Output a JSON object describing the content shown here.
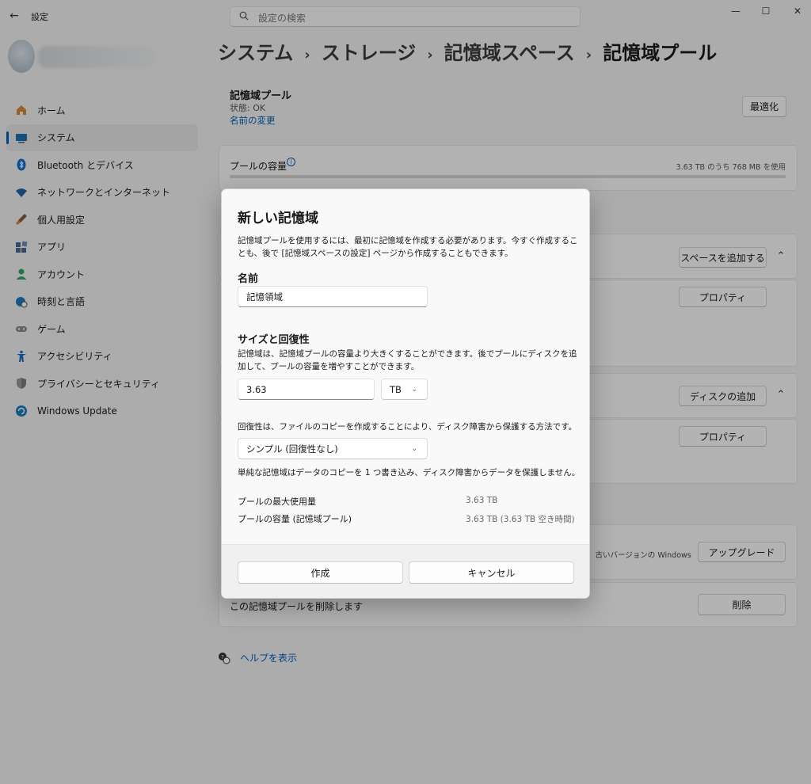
{
  "app": {
    "title": "設定"
  },
  "search": {
    "placeholder": "設定の検索"
  },
  "sidebar": {
    "items": [
      {
        "label": "ホーム",
        "icon": "home-icon",
        "color": "#d9883b"
      },
      {
        "label": "システム",
        "icon": "system-icon",
        "color": "#1f6fb2"
      },
      {
        "label": "Bluetooth とデバイス",
        "icon": "bluetooth-icon",
        "color": "#0a6ed1"
      },
      {
        "label": "ネットワークとインターネット",
        "icon": "wifi-icon",
        "color": "#2563a8"
      },
      {
        "label": "個人用設定",
        "icon": "brush-icon",
        "color": "#d2885a"
      },
      {
        "label": "アプリ",
        "icon": "apps-icon",
        "color": "#4a6c8c"
      },
      {
        "label": "アカウント",
        "icon": "account-icon",
        "color": "#2ea56b"
      },
      {
        "label": "時刻と言語",
        "icon": "globe-clock-icon",
        "color": "#1c7bc0"
      },
      {
        "label": "ゲーム",
        "icon": "gamepad-icon",
        "color": "#777777"
      },
      {
        "label": "アクセシビリティ",
        "icon": "accessibility-icon",
        "color": "#1c6fc4"
      },
      {
        "label": "プライバシーとセキュリティ",
        "icon": "shield-icon",
        "color": "#777777"
      },
      {
        "label": "Windows Update",
        "icon": "update-icon",
        "color": "#1c7bc0"
      }
    ]
  },
  "breadcrumb": [
    "システム",
    "ストレージ",
    "記憶域スペース",
    "記憶域プール"
  ],
  "pool": {
    "title": "記憶域プール",
    "status": "状態: OK",
    "rename": "名前の変更",
    "optimize": "最適化",
    "capacity_label": "プールの容量",
    "capacity_usage": "3.63 TB のうち 768 MB を使用"
  },
  "background": {
    "add_space": "スペースを追加する",
    "properties_1": "プロパティ",
    "add_disk": "ディスクの追加",
    "properties_2": "プロパティ",
    "old_version_text": "、古いバージョンの Windows",
    "upgrade": "アップグレード",
    "delete_text": "この記憶域プールを削除します",
    "delete": "削除",
    "help": "ヘルプを表示"
  },
  "dialog": {
    "title": "新しい記憶域",
    "description": "記憶域プールを使用するには、最初に記憶域を作成する必要があります。今すぐ作成することも、後で [記憶域スペースの設定] ページから作成することもできます。",
    "name_heading": "名前",
    "name_value": "記憶領域",
    "size_heading": "サイズと回復性",
    "size_description": "記憶域は、記憶域プールの容量より大きくすることができます。後でプールにディスクを追加して、プールの容量を増やすことができます。",
    "size_value": "3.63",
    "size_unit": "TB",
    "resiliency_description": "回復性は、ファイルのコピーを作成することにより、ディスク障害から保護する方法です。",
    "resiliency_value": "シンプル (回復性なし)",
    "resiliency_note": "単純な記憶域はデータのコピーを 1 つ書き込み、ディスク障害からデータを保護しません。",
    "max_usage_label": "プールの最大使用量",
    "max_usage_value": "3.63 TB",
    "capacity_label": "プールの容量 (記憶域プール)",
    "capacity_value": "3.63 TB (3.63 TB 空き時間)",
    "create": "作成",
    "cancel": "キャンセル"
  }
}
